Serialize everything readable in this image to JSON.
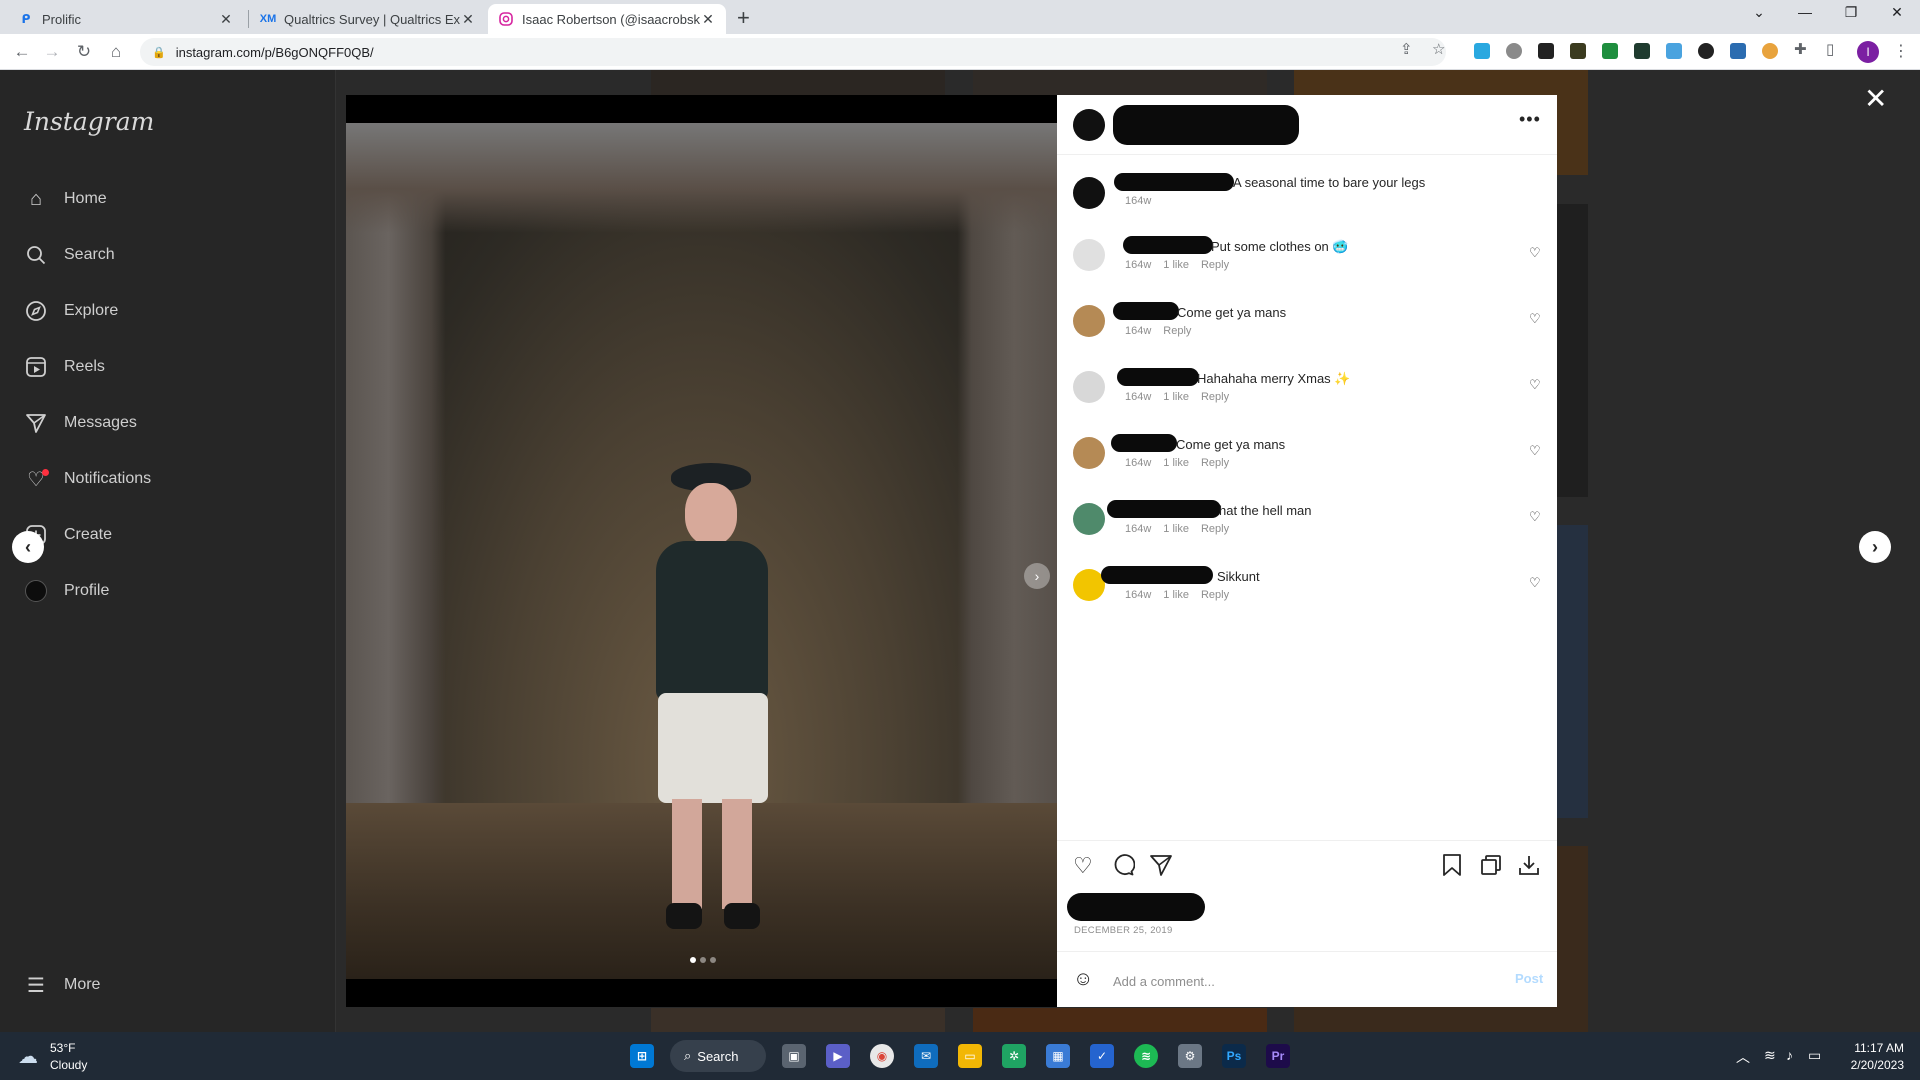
{
  "browser": {
    "tabs": [
      {
        "title": "Prolific",
        "favicon": "prolific-logo"
      },
      {
        "title": "Qualtrics Survey | Qualtrics Exper",
        "favicon": "XM"
      },
      {
        "title": "Isaac Robertson (@isaacrobskrrt)",
        "favicon": "instagram-logo"
      }
    ],
    "url": "instagram.com/p/B6gONQFF0QB/"
  },
  "instagram": {
    "logo": "Instagram",
    "nav": [
      {
        "label": "Home",
        "icon": "home-icon"
      },
      {
        "label": "Search",
        "icon": "search-icon"
      },
      {
        "label": "Explore",
        "icon": "explore-icon"
      },
      {
        "label": "Reels",
        "icon": "reels-icon"
      },
      {
        "label": "Messages",
        "icon": "messages-icon"
      },
      {
        "label": "Notifications",
        "icon": "heart-icon"
      },
      {
        "label": "Create",
        "icon": "create-icon"
      },
      {
        "label": "Profile",
        "icon": "profile-icon"
      }
    ],
    "more_label": "More"
  },
  "post": {
    "caption": {
      "text": "A seasonal time to bare your legs",
      "age": "164w"
    },
    "comments": [
      {
        "text": "Put some clothes on 🥶",
        "age": "164w",
        "likes": "1 like",
        "reply": "Reply"
      },
      {
        "text": "Come get ya mans",
        "age": "164w",
        "likes": "",
        "reply": "Reply"
      },
      {
        "text": "Hahahaha merry Xmas ✨",
        "age": "164w",
        "likes": "1 like",
        "reply": "Reply"
      },
      {
        "text": "Come get ya mans",
        "age": "164w",
        "likes": "1 like",
        "reply": "Reply"
      },
      {
        "text": "hat the hell man",
        "age": "164w",
        "likes": "1 like",
        "reply": "Reply"
      },
      {
        "text": "Sikkunt",
        "age": "164w",
        "likes": "1 like",
        "reply": "Reply"
      }
    ],
    "date": "DECEMBER 25, 2019",
    "comment_placeholder": "Add a comment...",
    "post_label": "Post"
  },
  "taskbar": {
    "weather_temp": "53°F",
    "weather_desc": "Cloudy",
    "search_label": "Search",
    "time": "11:17 AM",
    "date": "2/20/2023"
  }
}
